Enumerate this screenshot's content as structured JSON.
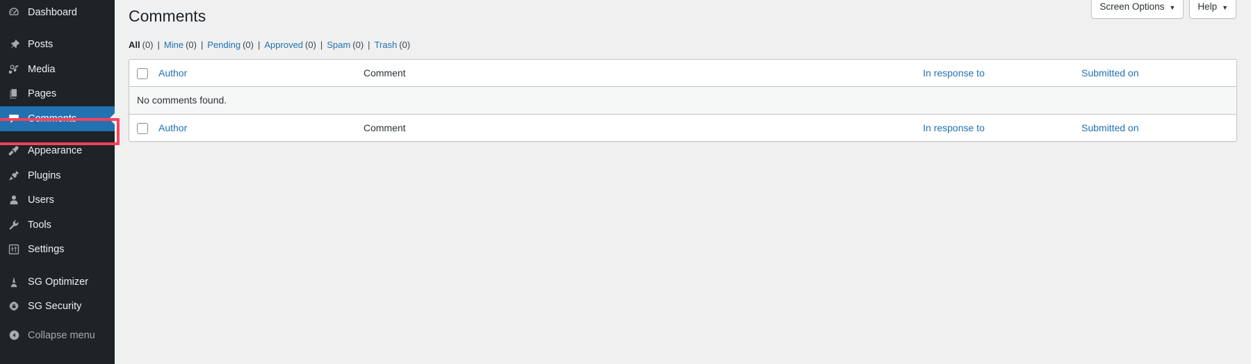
{
  "sidebar": {
    "items": [
      {
        "label": "Dashboard",
        "icon": "dashboard-icon",
        "active": false,
        "gap": false
      },
      {
        "label": "Posts",
        "icon": "pin-icon",
        "active": false,
        "gap": true
      },
      {
        "label": "Media",
        "icon": "media-icon",
        "active": false,
        "gap": false
      },
      {
        "label": "Pages",
        "icon": "pages-icon",
        "active": false,
        "gap": false
      },
      {
        "label": "Comments",
        "icon": "comments-icon",
        "active": true,
        "gap": false
      },
      {
        "label": "Appearance",
        "icon": "appearance-icon",
        "active": false,
        "gap": true
      },
      {
        "label": "Plugins",
        "icon": "plugins-icon",
        "active": false,
        "gap": false
      },
      {
        "label": "Users",
        "icon": "users-icon",
        "active": false,
        "gap": false
      },
      {
        "label": "Tools",
        "icon": "tools-icon",
        "active": false,
        "gap": false
      },
      {
        "label": "Settings",
        "icon": "settings-icon",
        "active": false,
        "gap": false
      },
      {
        "label": "SG Optimizer",
        "icon": "sg-optimizer-icon",
        "active": false,
        "gap": true
      },
      {
        "label": "SG Security",
        "icon": "sg-security-icon",
        "active": false,
        "gap": false
      }
    ],
    "collapse_label": "Collapse menu",
    "collapse_icon": "collapse-arrow-icon",
    "active_color": "#2271b1",
    "background": "#1d2327"
  },
  "highlight": {
    "color": "#f9415a",
    "target": "Comments"
  },
  "screen_meta": {
    "screen_options_label": "Screen Options",
    "help_label": "Help",
    "caret": "▼"
  },
  "page": {
    "title": "Comments"
  },
  "filters": [
    {
      "label": "All",
      "count": "(0)",
      "current": true
    },
    {
      "label": "Mine",
      "count": "(0)",
      "current": false
    },
    {
      "label": "Pending",
      "count": "(0)",
      "current": false
    },
    {
      "label": "Approved",
      "count": "(0)",
      "current": false
    },
    {
      "label": "Spam",
      "count": "(0)",
      "current": false
    },
    {
      "label": "Trash",
      "count": "(0)",
      "current": false
    }
  ],
  "filters_separator": "|",
  "table": {
    "columns": {
      "author": "Author",
      "comment": "Comment",
      "response": "In response to",
      "date": "Submitted on"
    },
    "empty_message": "No comments found.",
    "rows": []
  }
}
